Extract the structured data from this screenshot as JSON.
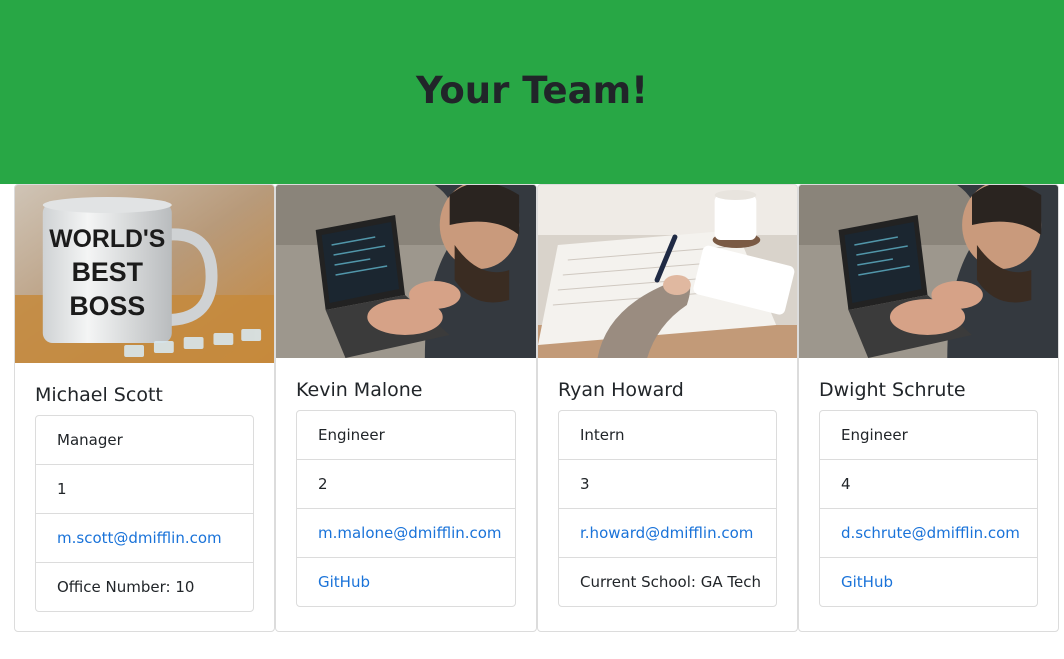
{
  "header": {
    "title": "Your Team!"
  },
  "colors": {
    "hero": "#28a745",
    "link": "#1a73d9"
  },
  "team": [
    {
      "name": "Michael Scott",
      "role": "Manager",
      "id": "1",
      "email": "m.scott@dmifflin.com",
      "extra": "Office Number: 10",
      "image": "mug-photo",
      "mug_text": [
        "WORLD'S",
        "BEST",
        "BOSS"
      ]
    },
    {
      "name": "Kevin Malone",
      "role": "Engineer",
      "id": "2",
      "email": "m.malone@dmifflin.com",
      "extra": "GitHub",
      "image": "laptop-photo"
    },
    {
      "name": "Ryan Howard",
      "role": "Intern",
      "id": "3",
      "email": "r.howard@dmifflin.com",
      "extra": "Current School: GA Tech",
      "image": "writing-photo"
    },
    {
      "name": "Dwight Schrute",
      "role": "Engineer",
      "id": "4",
      "email": "d.schrute@dmifflin.com",
      "extra": "GitHub",
      "image": "laptop-photo"
    }
  ]
}
